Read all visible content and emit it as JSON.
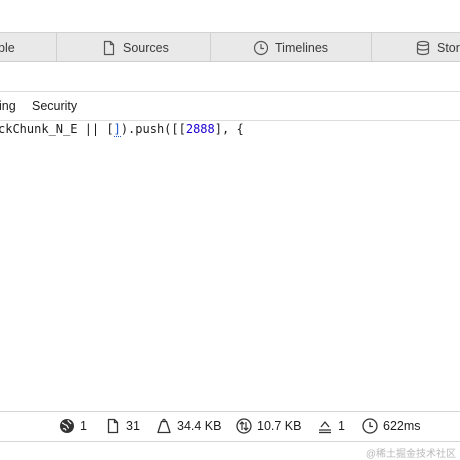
{
  "tabs": [
    {
      "label": "ble",
      "icon": "table-icon"
    },
    {
      "label": "Sources",
      "icon": "document-icon"
    },
    {
      "label": "Timelines",
      "icon": "clock-icon"
    },
    {
      "label": "Stor",
      "icon": "database-icon"
    }
  ],
  "subtabs": {
    "timing": "ing",
    "security": "Security"
  },
  "code": {
    "prefix": "ckChunk_N_E || [",
    "highlight": "]",
    "middle": ").push([[",
    "number": "2888",
    "suffix": "], {"
  },
  "status": {
    "resources": "1",
    "documents": "31",
    "transferred": "34.4 KB",
    "size": "10.7 KB",
    "redirects": "1",
    "time": "622ms"
  },
  "watermark": "@稀土掘金技术社区"
}
